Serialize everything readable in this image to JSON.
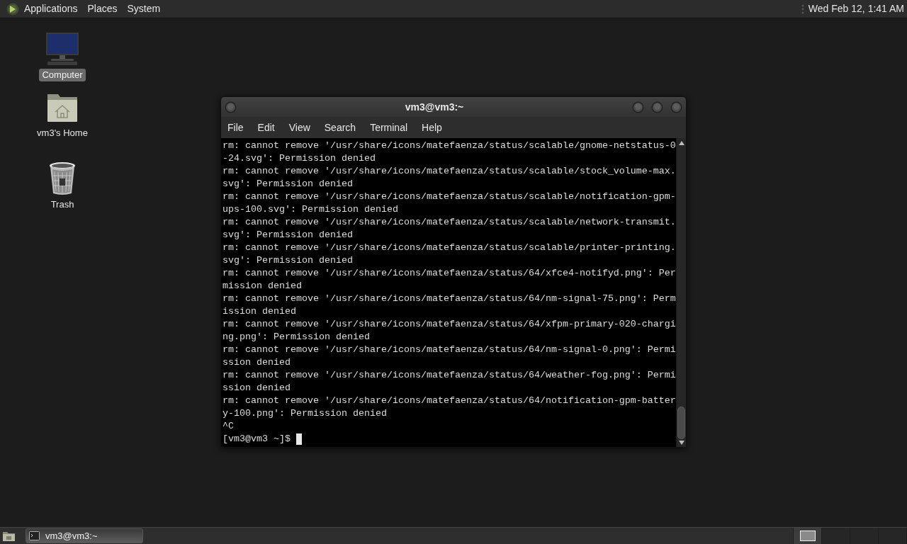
{
  "top_panel": {
    "menus": [
      "Applications",
      "Places",
      "System"
    ],
    "clock": "Wed Feb 12, 1:41 AM"
  },
  "desktop_icons": [
    {
      "kind": "computer",
      "label": "Computer",
      "selected": true
    },
    {
      "kind": "home",
      "label": "vm3's Home",
      "selected": false
    },
    {
      "kind": "trash",
      "label": "Trash",
      "selected": false
    }
  ],
  "terminal": {
    "title": "vm3@vm3:~",
    "menu": [
      "File",
      "Edit",
      "View",
      "Search",
      "Terminal",
      "Help"
    ],
    "lines": [
      "rm: cannot remove '/usr/share/icons/matefaenza/status/scalable/gnome-netstatus-0",
      "-24.svg': Permission denied",
      "rm: cannot remove '/usr/share/icons/matefaenza/status/scalable/stock_volume-max.",
      "svg': Permission denied",
      "rm: cannot remove '/usr/share/icons/matefaenza/status/scalable/notification-gpm-",
      "ups-100.svg': Permission denied",
      "rm: cannot remove '/usr/share/icons/matefaenza/status/scalable/network-transmit.",
      "svg': Permission denied",
      "rm: cannot remove '/usr/share/icons/matefaenza/status/scalable/printer-printing.",
      "svg': Permission denied",
      "rm: cannot remove '/usr/share/icons/matefaenza/status/64/xfce4-notifyd.png': Per",
      "mission denied",
      "rm: cannot remove '/usr/share/icons/matefaenza/status/64/nm-signal-75.png': Perm",
      "ission denied",
      "rm: cannot remove '/usr/share/icons/matefaenza/status/64/xfpm-primary-020-chargi",
      "ng.png': Permission denied",
      "rm: cannot remove '/usr/share/icons/matefaenza/status/64/nm-signal-0.png': Permi",
      "ssion denied",
      "rm: cannot remove '/usr/share/icons/matefaenza/status/64/weather-fog.png': Permi",
      "ssion denied",
      "rm: cannot remove '/usr/share/icons/matefaenza/status/64/notification-gpm-batter",
      "y-100.png': Permission denied",
      "^C"
    ],
    "prompt": "[vm3@vm3 ~]$"
  },
  "bottom_panel": {
    "tasks": [
      {
        "label": "vm3@vm3:~",
        "selected": true
      }
    ],
    "workspaces": [
      {
        "selected": true,
        "has_window": true
      },
      {
        "selected": false,
        "has_window": false
      },
      {
        "selected": false,
        "has_window": false
      },
      {
        "selected": false,
        "has_window": false
      }
    ]
  }
}
